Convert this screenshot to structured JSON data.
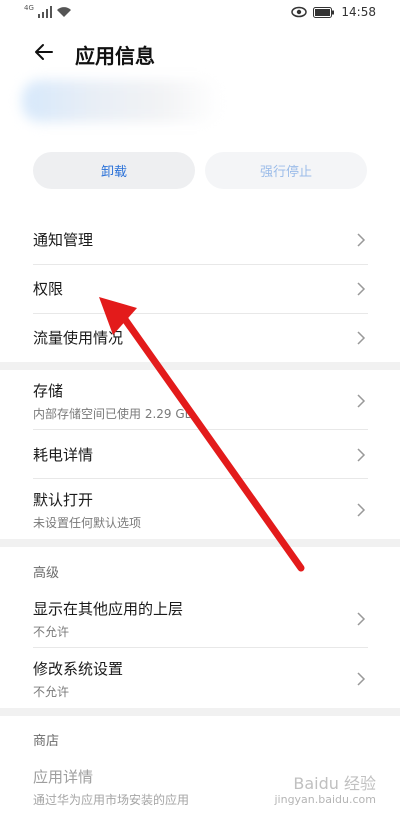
{
  "status": {
    "network_label": "4G",
    "time": "14:58"
  },
  "header": {
    "title": "应用信息"
  },
  "actions": {
    "uninstall_label": "卸载",
    "force_stop_label": "强行停止"
  },
  "list_group_1": [
    {
      "label": "通知管理"
    },
    {
      "label": "权限"
    },
    {
      "label": "流量使用情况"
    }
  ],
  "list_group_2": [
    {
      "label": "存储",
      "sub": "内部存储空间已使用 2.29 GB"
    },
    {
      "label": "耗电详情"
    },
    {
      "label": "默认打开",
      "sub": "未设置任何默认选项"
    }
  ],
  "advanced": {
    "section_label": "高级",
    "items": [
      {
        "label": "显示在其他应用的上层",
        "sub": "不允许"
      },
      {
        "label": "修改系统设置",
        "sub": "不允许"
      }
    ]
  },
  "store": {
    "section_label": "商店",
    "item": {
      "label": "应用详情",
      "sub": "通过华为应用市场安装的应用"
    }
  },
  "annotation": {
    "arrow_color": "#e31b1b"
  },
  "watermark": {
    "line1": "Baidu 经验",
    "line2": "jingyan.baidu.com"
  }
}
